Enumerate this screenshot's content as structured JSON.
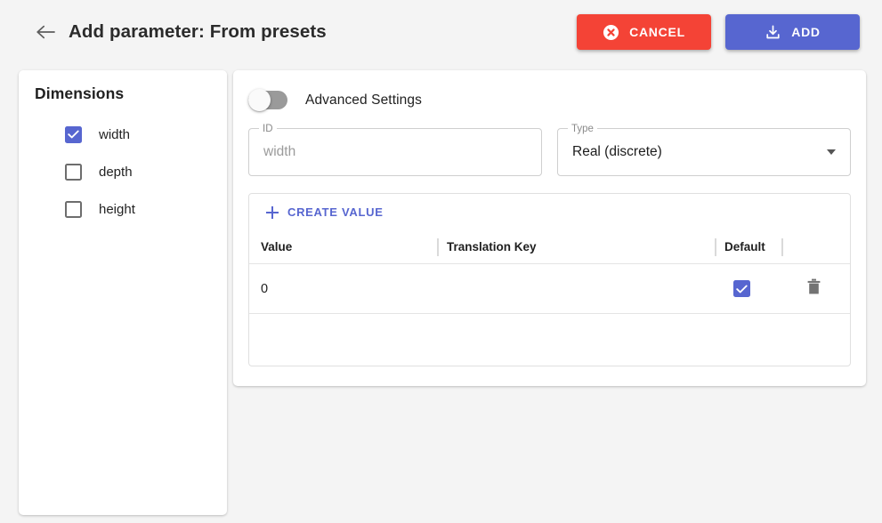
{
  "header": {
    "back_icon": "arrow-left-icon",
    "title": "Add parameter: From presets",
    "cancel_label": "CANCEL",
    "cancel_icon": "cancel-circle-icon",
    "cancel_color": "#f44336",
    "add_label": "ADD",
    "add_icon": "save-download-icon",
    "add_color": "#5766d0"
  },
  "sidebar": {
    "title": "Dimensions",
    "items": [
      {
        "label": "width",
        "checked": true
      },
      {
        "label": "depth",
        "checked": false
      },
      {
        "label": "height",
        "checked": false
      }
    ]
  },
  "main": {
    "advanced_settings": {
      "label": "Advanced Settings",
      "enabled": false
    },
    "id_field": {
      "legend": "ID",
      "value": "",
      "placeholder": "width"
    },
    "type_field": {
      "legend": "Type",
      "value": "Real (discrete)",
      "arrow_icon": "chevron-down-icon"
    },
    "values_table": {
      "create_label": "CREATE VALUE",
      "create_icon": "plus-icon",
      "columns": [
        "Value",
        "Translation Key",
        "Default"
      ],
      "rows": [
        {
          "value": "0",
          "translation_key": "",
          "default": true,
          "delete_icon": "trash-icon"
        }
      ]
    }
  },
  "colors": {
    "accent": "#5766d0",
    "danger": "#f44336",
    "page_background": "#f4f4f4"
  }
}
